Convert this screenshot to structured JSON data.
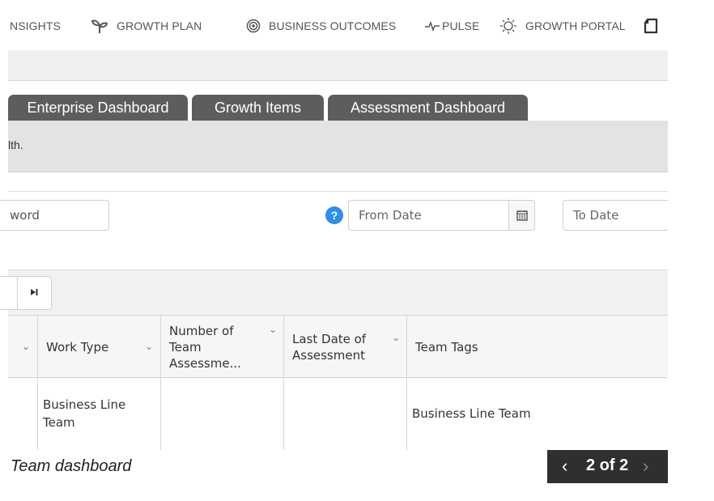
{
  "nav": {
    "items": [
      {
        "label": "NSIGHTS",
        "icon": "insights-icon"
      },
      {
        "label": "GROWTH PLAN",
        "icon": "sprout-icon"
      },
      {
        "label": "BUSINESS OUTCOMES",
        "icon": "target-icon"
      },
      {
        "label": "PULSE",
        "icon": "pulse-icon"
      },
      {
        "label": "GROWTH PORTAL",
        "icon": "bulb-icon"
      }
    ],
    "extra_icon": "document-icon"
  },
  "tabs": [
    "Enterprise Dashboard",
    "Growth Items",
    "Assessment Dashboard"
  ],
  "info_text": "lth.",
  "filters": {
    "keyword_value": "word",
    "from_date_placeholder": "From Date",
    "to_date_placeholder": "To Date",
    "help_label": "?"
  },
  "pager_buttons": {
    "last": "⏭"
  },
  "table": {
    "columns": [
      "Work Type",
      "Number of Team Assessme...",
      "Last Date of Assessment",
      "Team Tags"
    ],
    "rows": [
      {
        "work_type": "Business Line Team",
        "num_assessments": "",
        "last_date": "",
        "team_tags": "Business Line Team"
      }
    ]
  },
  "caption": "Team dashboard",
  "slide_pager": {
    "text": "2 of 2",
    "prev": "‹",
    "next": "›"
  },
  "colors": {
    "tab_bg": "#5d5d5d",
    "help_blue": "#2e8fe6",
    "pager_bg": "#2f2f2f"
  }
}
